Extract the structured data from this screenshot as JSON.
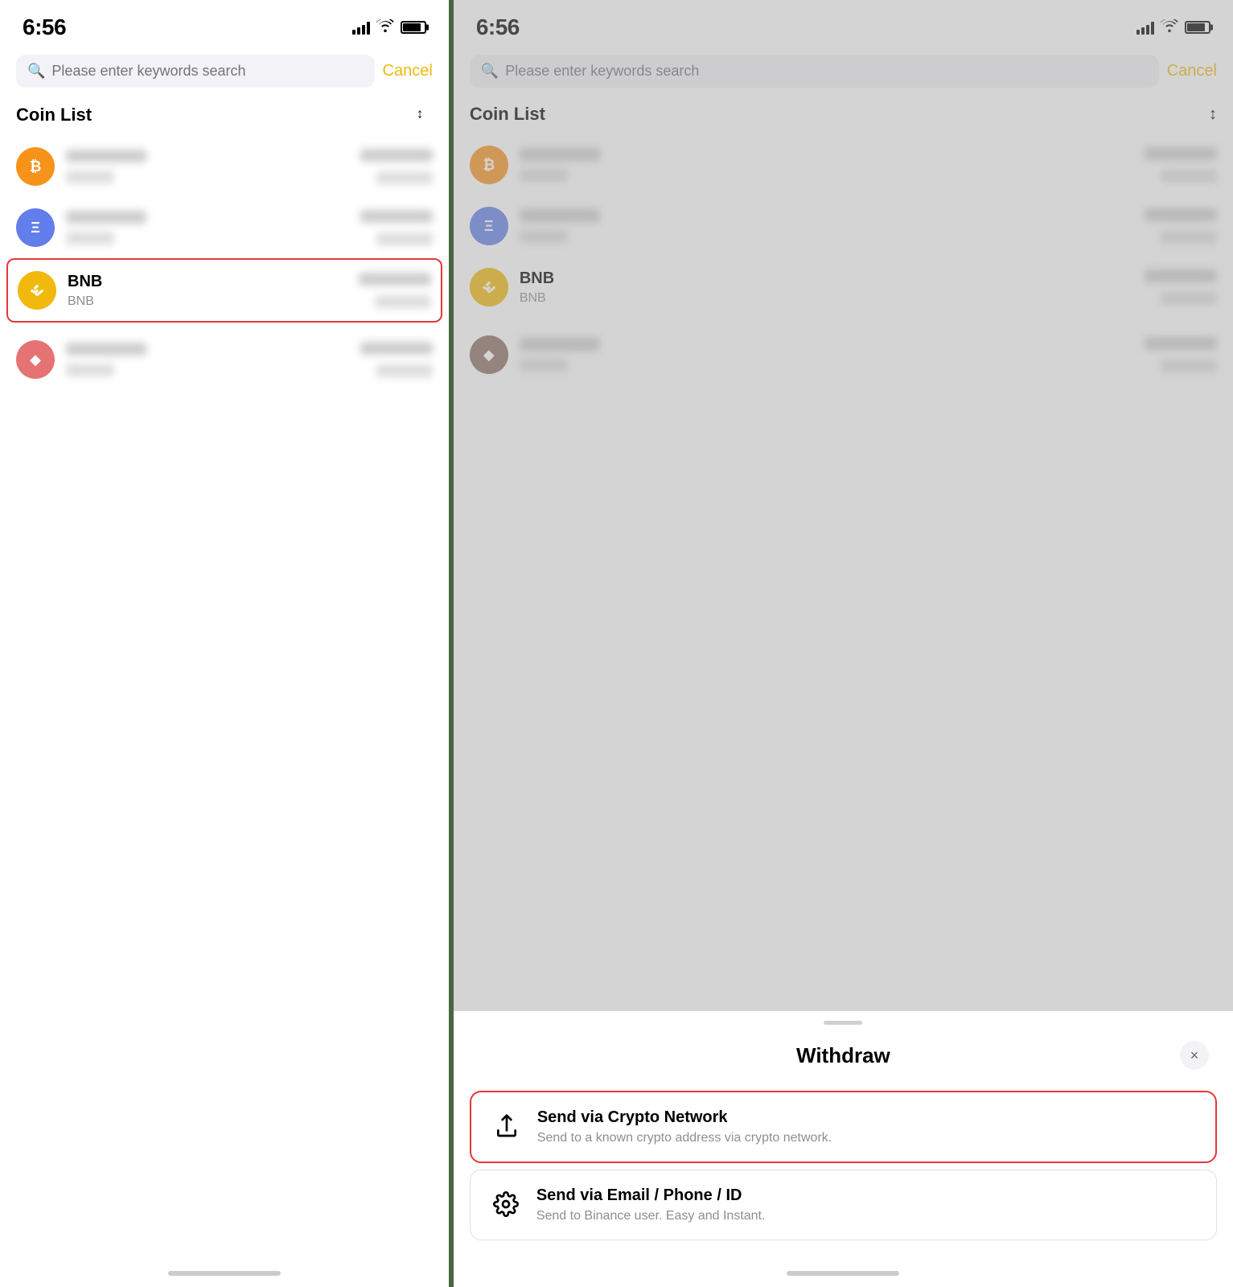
{
  "left": {
    "statusBar": {
      "time": "6:56"
    },
    "searchBar": {
      "placeholder": "Please enter keywords search",
      "cancelLabel": "Cancel"
    },
    "coinList": {
      "title": "Coin List",
      "items": [
        {
          "id": "coin1",
          "logoType": "orange",
          "logoSymbol": "₿",
          "name": "BLURRED",
          "symbol": "BLURRED",
          "blurred": true
        },
        {
          "id": "coin2",
          "logoType": "blue",
          "logoSymbol": "Ξ",
          "name": "BLURRED",
          "symbol": "BLURRED",
          "blurred": true
        },
        {
          "id": "bnb",
          "logoType": "yellow",
          "logoSymbol": "⬡",
          "name": "BNB",
          "symbol": "BNB",
          "highlighted": true,
          "blurred": false
        },
        {
          "id": "coin4",
          "logoType": "pink",
          "logoSymbol": "◆",
          "name": "BLURRED",
          "symbol": "BLURRED",
          "blurred": true
        }
      ]
    }
  },
  "right": {
    "statusBar": {
      "time": "6:56"
    },
    "searchBar": {
      "placeholder": "Please enter keywords search",
      "cancelLabel": "Cancel"
    },
    "coinList": {
      "title": "Coin List"
    },
    "coinItems": [
      {
        "logoType": "orange",
        "name": "BTC",
        "symbol": "BTC",
        "blurred": true
      },
      {
        "logoType": "blue",
        "name": "ETH",
        "symbol": "ETH",
        "blurred": true
      },
      {
        "logoType": "yellow",
        "name": "BNB",
        "symbol": "BNB",
        "blurred": false
      },
      {
        "logoType": "pink",
        "name": "BLURRED",
        "symbol": "BLURRED",
        "blurred": true
      }
    ],
    "bottomSheet": {
      "title": "Withdraw",
      "closeLabel": "×",
      "options": [
        {
          "id": "crypto-network",
          "icon": "⬆",
          "title": "Send via Crypto Network",
          "description": "Send to a known crypto address via crypto network.",
          "highlighted": true
        },
        {
          "id": "email-phone",
          "icon": "🔗",
          "title": "Send via Email / Phone / ID",
          "description": "Send to Binance user. Easy and Instant.",
          "highlighted": false
        }
      ]
    }
  }
}
